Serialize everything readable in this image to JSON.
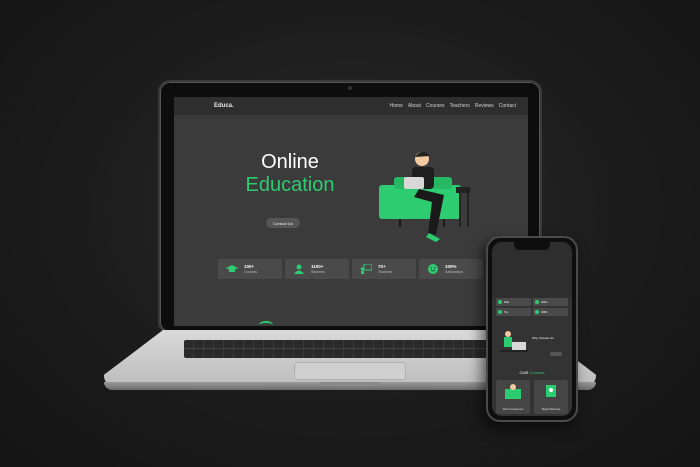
{
  "site": {
    "logo": "Educa.",
    "nav": [
      "Home",
      "About",
      "Courses",
      "Teachers",
      "Reviews",
      "Contact"
    ],
    "hero": {
      "line1": "Online",
      "line2": "Education",
      "button": "Contact Us"
    },
    "stats": [
      {
        "value": "100+",
        "label": "Courses",
        "icon": "graduation-cap-icon"
      },
      {
        "value": "1100+",
        "label": "Students",
        "icon": "students-icon"
      },
      {
        "value": "70+",
        "label": "Teachers",
        "icon": "teacher-icon"
      },
      {
        "value": "100%",
        "label": "Satisfaction",
        "icon": "smile-icon"
      }
    ]
  },
  "phone": {
    "stats": [
      "100+",
      "1100+",
      "70+",
      "100%"
    ],
    "why_title": "Why Choose Us",
    "courses_title_1": "OUR",
    "courses_title_2": "Courses",
    "cards": [
      "Web Development",
      "Digital Marketing"
    ]
  },
  "colors": {
    "accent": "#2ecc71",
    "background": "#1c1c1c",
    "site_bg": "#3b3b3b"
  }
}
